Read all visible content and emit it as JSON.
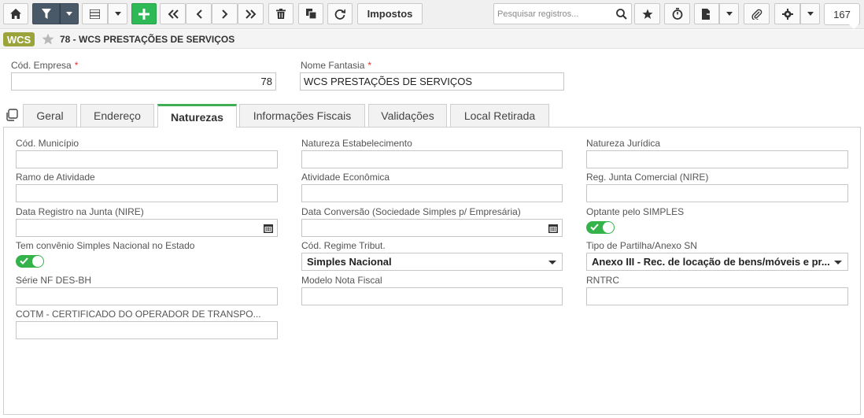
{
  "toolbar": {
    "search_placeholder": "Pesquisar registros...",
    "impostos_label": "Impostos",
    "record_count": "167"
  },
  "header": {
    "badge": "WCS",
    "title": "78 - WCS PRESTAÇÕES DE SERVIÇOS"
  },
  "top_fields": {
    "cod_empresa_label": "Cód. Empresa",
    "cod_empresa_value": "78",
    "nome_fantasia_label": "Nome Fantasia",
    "nome_fantasia_value": "WCS PRESTAÇÕES DE SERVIÇOS",
    "required_mark": "*"
  },
  "tabs": [
    {
      "label": "Geral"
    },
    {
      "label": "Endereço"
    },
    {
      "label": "Naturezas"
    },
    {
      "label": "Informações Fiscais"
    },
    {
      "label": "Validações"
    },
    {
      "label": "Local Retirada"
    }
  ],
  "active_tab": "Naturezas",
  "form": {
    "cod_municipio": "Cód. Município",
    "natureza_estabelecimento": "Natureza Estabelecimento",
    "natureza_juridica": "Natureza Jurídica",
    "ramo_atividade": "Ramo de Atividade",
    "atividade_economica": "Atividade Econômica",
    "reg_junta": "Reg. Junta Comercial (NIRE)",
    "data_registro": "Data Registro na Junta (NIRE)",
    "data_conversao": "Data Conversão (Sociedade Simples p/ Empresária)",
    "optante_simples": "Optante pelo SIMPLES",
    "convenio_simples": "Tem convênio Simples Nacional no Estado",
    "cod_regime": "Cód. Regime Tribut.",
    "cod_regime_value": "Simples Nacional",
    "tipo_partilha": "Tipo de Partilha/Anexo SN",
    "tipo_partilha_value": "Anexo III - Rec. de locação de bens/móveis e pr...",
    "serie_nf": "Série NF DES-BH",
    "modelo_nf": "Modelo Nota Fiscal",
    "rntrc": "RNTRC",
    "cotm": "COTM - CERTIFICADO DO OPERADOR DE TRANSPO..."
  },
  "toggles": {
    "optante_simples_on": true,
    "convenio_simples_on": true
  },
  "colors": {
    "toolbar_dark": "#4a5968",
    "add_green": "#2eb957",
    "badge_olive": "#9aa43a",
    "active_tab_accent": "#3fae55",
    "toggle_on": "#34b34a",
    "required": "#e03030"
  },
  "icons": [
    "home-icon",
    "filter-icon",
    "chevron-down-icon",
    "list-icon",
    "plus-icon",
    "first-icon",
    "prev-icon",
    "next-icon",
    "last-icon",
    "trash-icon",
    "copy-icon",
    "refresh-icon",
    "search-icon",
    "star-icon",
    "timer-icon",
    "export-icon",
    "paperclip-icon",
    "gear-icon",
    "calendar-icon",
    "duplicate-icon",
    "check-icon"
  ]
}
